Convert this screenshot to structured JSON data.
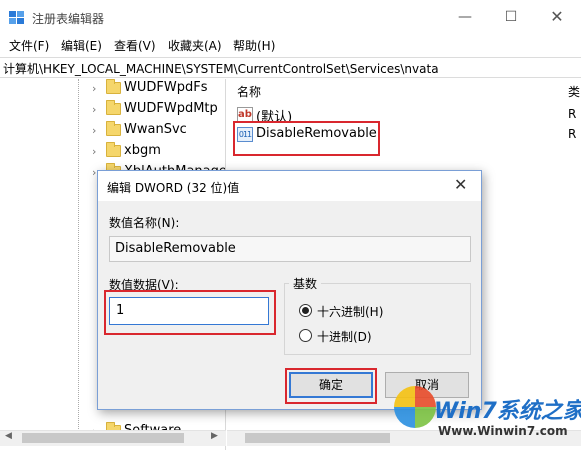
{
  "window": {
    "title": "注册表编辑器",
    "minimize_glyph": "—",
    "maximize_glyph": "☐",
    "close_glyph": "✕"
  },
  "menu": [
    "文件(F)",
    "编辑(E)",
    "查看(V)",
    "收藏夹(A)",
    "帮助(H)"
  ],
  "address": "计算机\\HKEY_LOCAL_MACHINE\\SYSTEM\\CurrentControlSet\\Services\\nvata",
  "tree": {
    "items": [
      "WUDFWpdFs",
      "WUDFWpdMtp",
      "WwanSvc",
      "xbgm",
      "XblAuthManager"
    ],
    "bottom_item": "Software",
    "expander_icon": "chevron-right-icon"
  },
  "list": {
    "col_name": "名称",
    "col_type": "类",
    "rows": [
      {
        "name": "(默认)",
        "icon": "string-value-icon",
        "type": "R"
      },
      {
        "name": "DisableRemovable",
        "icon": "dword-value-icon",
        "type": "R"
      }
    ]
  },
  "dialog": {
    "title": "编辑 DWORD (32 位)值",
    "value_name_label": "数值名称(N):",
    "value_name": "DisableRemovable",
    "value_data_label": "数值数据(V):",
    "value_data": "1",
    "base_label": "基数",
    "radio_hex": "十六进制(H)",
    "radio_dec": "十进制(D)",
    "base_selected": "hex",
    "ok": "确定",
    "cancel": "取消"
  },
  "highlight_color": "#d9272e",
  "watermark": {
    "brand": "Win7系统之家",
    "url": "Www.Winwin7.com"
  }
}
